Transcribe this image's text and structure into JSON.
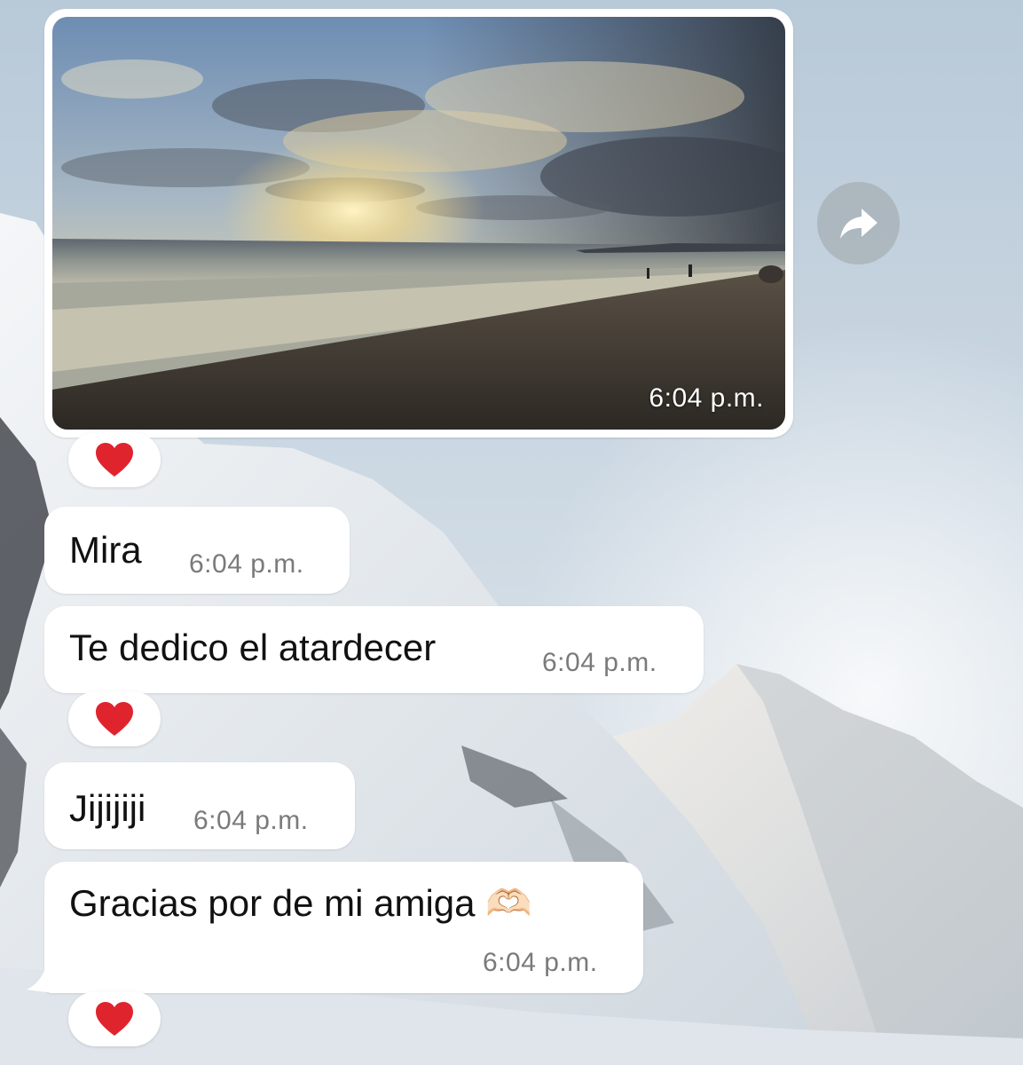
{
  "media_message": {
    "time": "6:04 p.m.",
    "reaction": "heart-emoji",
    "image": "beach-sunset-photo"
  },
  "messages": [
    {
      "text": "Mira",
      "time": "6:04 p.m."
    },
    {
      "text": "Te dedico el atardecer",
      "time": "6:04 p.m.",
      "reaction": "heart-emoji"
    },
    {
      "text": "Jijijiji",
      "time": "6:04 p.m."
    },
    {
      "text": "Gracias por de mi amiga 🫶🏻",
      "time": "6:04 p.m.",
      "reaction": "heart-emoji"
    }
  ],
  "icons": {
    "forward": "forward-arrow-icon",
    "reaction": "red-heart-icon"
  },
  "colors": {
    "bubble": "#ffffff",
    "time_text": "#7a7a7a",
    "heart": "#e0242e",
    "forward_button": "#a5afb4"
  }
}
